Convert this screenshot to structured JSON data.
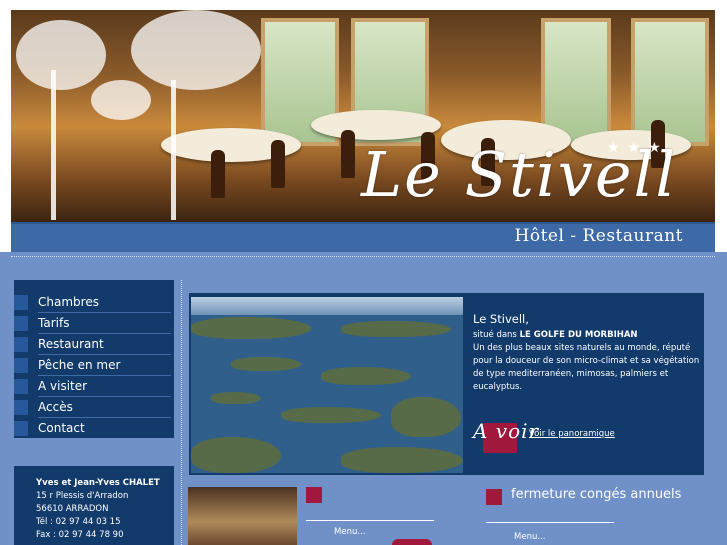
{
  "banner": {
    "logo_name": "Le Stivell",
    "stars": "★★★",
    "subtitle": "Hôtel - Restaurant"
  },
  "menu": {
    "items": [
      {
        "label": "Chambres"
      },
      {
        "label": "Tarifs"
      },
      {
        "label": "Restaurant"
      },
      {
        "label": "Pêche en mer"
      },
      {
        "label": "A visiter"
      },
      {
        "label": "Accès"
      },
      {
        "label": "Contact"
      }
    ]
  },
  "contact": {
    "names": "Yves et Jean-Yves CHALET",
    "street": "15 r Plessis d'Arradon",
    "city": "56610 ARRADON",
    "tel": "Tél : 02 97 44 03 15",
    "fax": "Fax : 02 97 44 78 90"
  },
  "feature": {
    "title": "Le Stivell",
    "title_suffix": ",",
    "intro": "situé dans",
    "place": "LE GOLFE DU MORBIHAN",
    "description": "Un des plus beaux sites naturels au monde, réputé pour la douceur de son micro-climat et sa végétation de type mediterranéen, mimosas, palmiers et eucalyptus.",
    "avoir_script": "A voir",
    "panorama_link": "Voir le panoramique"
  },
  "news": {
    "left_menu_link": "Menu...",
    "closure_title": "fermeture congés annuels",
    "right_menu_link": "Menu..."
  },
  "colors": {
    "navy": "#123a6b",
    "mid_blue": "#7090c8",
    "accent_red": "#a0193c"
  }
}
